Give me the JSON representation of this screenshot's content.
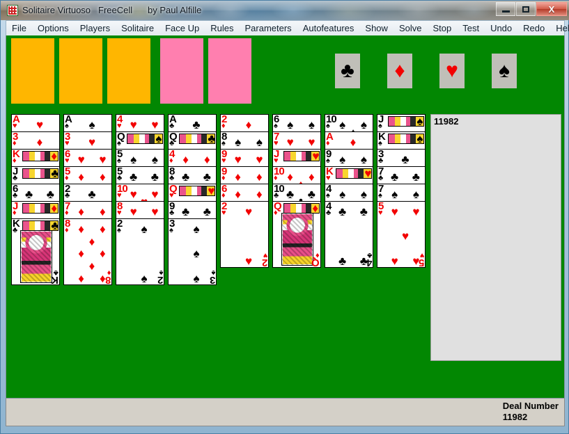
{
  "window": {
    "app_title": "Solitaire Virtuoso",
    "game_name": "FreeCell",
    "author": "by Paul Alfille",
    "minimize_label": "Minimize",
    "maximize_label": "Maximize",
    "close_label": "X"
  },
  "menubar": {
    "items": [
      {
        "label": "File"
      },
      {
        "label": "Options"
      },
      {
        "label": "Players"
      },
      {
        "label": "Solitaire"
      },
      {
        "label": "Face Up"
      },
      {
        "label": "Rules"
      },
      {
        "label": "Parameters"
      },
      {
        "label": "Autofeatures"
      },
      {
        "label": "Show"
      },
      {
        "label": "Solve"
      },
      {
        "label": "Stop"
      },
      {
        "label": "Test"
      },
      {
        "label": "Undo"
      },
      {
        "label": "Redo"
      },
      {
        "label": "Help"
      }
    ]
  },
  "colors": {
    "baize_green": "#028702",
    "freecell_gold": "#ffb600",
    "freecell_pink": "#ff7faf",
    "card_red": "#f20000",
    "card_black": "#000000",
    "foundation_plate": "#c0bfb8",
    "panel_gray": "#e0e0e0",
    "statusbar_gray": "#d4d0c8"
  },
  "free_cells": [
    {
      "name": "free-cell-1",
      "fill": "gold",
      "card": null
    },
    {
      "name": "free-cell-2",
      "fill": "gold",
      "card": null
    },
    {
      "name": "free-cell-3",
      "fill": "gold",
      "card": null
    },
    {
      "name": "free-cell-4",
      "fill": "pink",
      "card": null
    },
    {
      "name": "free-cell-5",
      "fill": "pink",
      "card": null
    }
  ],
  "foundations": [
    {
      "suit": "clubs",
      "glyph": "♣",
      "color": "black",
      "top_card": null
    },
    {
      "suit": "diamonds",
      "glyph": "♦",
      "color": "red",
      "top_card": null
    },
    {
      "suit": "hearts",
      "glyph": "♥",
      "color": "red",
      "top_card": null
    },
    {
      "suit": "spades",
      "glyph": "♠",
      "color": "black",
      "top_card": null
    }
  ],
  "tableau": [
    {
      "column": 1,
      "cards": [
        {
          "rank": "A",
          "suit": "hearts",
          "glyph": "♥",
          "color": "red"
        },
        {
          "rank": "3",
          "suit": "diamonds",
          "glyph": "♦",
          "color": "red"
        },
        {
          "rank": "K",
          "suit": "diamonds",
          "glyph": "♦",
          "color": "red"
        },
        {
          "rank": "J",
          "suit": "clubs",
          "glyph": "♣",
          "color": "black"
        },
        {
          "rank": "6",
          "suit": "clubs",
          "glyph": "♣",
          "color": "black"
        },
        {
          "rank": "J",
          "suit": "diamonds",
          "glyph": "♦",
          "color": "red"
        },
        {
          "rank": "K",
          "suit": "clubs",
          "glyph": "♣",
          "color": "black"
        }
      ]
    },
    {
      "column": 2,
      "cards": [
        {
          "rank": "A",
          "suit": "spades",
          "glyph": "♠",
          "color": "black"
        },
        {
          "rank": "3",
          "suit": "hearts",
          "glyph": "♥",
          "color": "red"
        },
        {
          "rank": "6",
          "suit": "hearts",
          "glyph": "♥",
          "color": "red"
        },
        {
          "rank": "5",
          "suit": "diamonds",
          "glyph": "♦",
          "color": "red"
        },
        {
          "rank": "2",
          "suit": "clubs",
          "glyph": "♣",
          "color": "black"
        },
        {
          "rank": "7",
          "suit": "diamonds",
          "glyph": "♦",
          "color": "red"
        },
        {
          "rank": "8",
          "suit": "diamonds",
          "glyph": "♦",
          "color": "red"
        }
      ]
    },
    {
      "column": 3,
      "cards": [
        {
          "rank": "4",
          "suit": "hearts",
          "glyph": "♥",
          "color": "red"
        },
        {
          "rank": "Q",
          "suit": "spades",
          "glyph": "♠",
          "color": "black"
        },
        {
          "rank": "5",
          "suit": "spades",
          "glyph": "♠",
          "color": "black"
        },
        {
          "rank": "5",
          "suit": "clubs",
          "glyph": "♣",
          "color": "black"
        },
        {
          "rank": "10",
          "suit": "hearts",
          "glyph": "♥",
          "color": "red"
        },
        {
          "rank": "8",
          "suit": "hearts",
          "glyph": "♥",
          "color": "red"
        },
        {
          "rank": "2",
          "suit": "spades",
          "glyph": "♠",
          "color": "black"
        }
      ]
    },
    {
      "column": 4,
      "cards": [
        {
          "rank": "A",
          "suit": "clubs",
          "glyph": "♣",
          "color": "black"
        },
        {
          "rank": "Q",
          "suit": "clubs",
          "glyph": "♣",
          "color": "black"
        },
        {
          "rank": "4",
          "suit": "diamonds",
          "glyph": "♦",
          "color": "red"
        },
        {
          "rank": "8",
          "suit": "clubs",
          "glyph": "♣",
          "color": "black"
        },
        {
          "rank": "Q",
          "suit": "hearts",
          "glyph": "♥",
          "color": "red"
        },
        {
          "rank": "9",
          "suit": "clubs",
          "glyph": "♣",
          "color": "black"
        },
        {
          "rank": "3",
          "suit": "spades",
          "glyph": "♠",
          "color": "black"
        }
      ]
    },
    {
      "column": 5,
      "cards": [
        {
          "rank": "2",
          "suit": "diamonds",
          "glyph": "♦",
          "color": "red"
        },
        {
          "rank": "8",
          "suit": "spades",
          "glyph": "♠",
          "color": "black"
        },
        {
          "rank": "9",
          "suit": "hearts",
          "glyph": "♥",
          "color": "red"
        },
        {
          "rank": "9",
          "suit": "diamonds",
          "glyph": "♦",
          "color": "red"
        },
        {
          "rank": "6",
          "suit": "diamonds",
          "glyph": "♦",
          "color": "red"
        },
        {
          "rank": "2",
          "suit": "hearts",
          "glyph": "♥",
          "color": "red"
        }
      ]
    },
    {
      "column": 6,
      "cards": [
        {
          "rank": "6",
          "suit": "spades",
          "glyph": "♠",
          "color": "black"
        },
        {
          "rank": "7",
          "suit": "hearts",
          "glyph": "♥",
          "color": "red"
        },
        {
          "rank": "J",
          "suit": "hearts",
          "glyph": "♥",
          "color": "red"
        },
        {
          "rank": "10",
          "suit": "diamonds",
          "glyph": "♦",
          "color": "red"
        },
        {
          "rank": "10",
          "suit": "clubs",
          "glyph": "♣",
          "color": "black"
        },
        {
          "rank": "Q",
          "suit": "diamonds",
          "glyph": "♦",
          "color": "red"
        }
      ]
    },
    {
      "column": 7,
      "cards": [
        {
          "rank": "10",
          "suit": "spades",
          "glyph": "♠",
          "color": "black"
        },
        {
          "rank": "A",
          "suit": "diamonds",
          "glyph": "♦",
          "color": "red"
        },
        {
          "rank": "9",
          "suit": "spades",
          "glyph": "♠",
          "color": "black"
        },
        {
          "rank": "K",
          "suit": "hearts",
          "glyph": "♥",
          "color": "red"
        },
        {
          "rank": "4",
          "suit": "spades",
          "glyph": "♠",
          "color": "black"
        },
        {
          "rank": "4",
          "suit": "clubs",
          "glyph": "♣",
          "color": "black"
        }
      ]
    },
    {
      "column": 8,
      "cards": [
        {
          "rank": "J",
          "suit": "spades",
          "glyph": "♠",
          "color": "black"
        },
        {
          "rank": "K",
          "suit": "spades",
          "glyph": "♠",
          "color": "black"
        },
        {
          "rank": "3",
          "suit": "clubs",
          "glyph": "♣",
          "color": "black"
        },
        {
          "rank": "7",
          "suit": "clubs",
          "glyph": "♣",
          "color": "black"
        },
        {
          "rank": "7",
          "suit": "spades",
          "glyph": "♠",
          "color": "black"
        },
        {
          "rank": "5",
          "suit": "hearts",
          "glyph": "♥",
          "color": "red"
        }
      ]
    }
  ],
  "info_panel": {
    "deal_number_value": "11982"
  },
  "statusbar": {
    "deal_number_label": "Deal Number",
    "deal_number_value": "11982"
  }
}
